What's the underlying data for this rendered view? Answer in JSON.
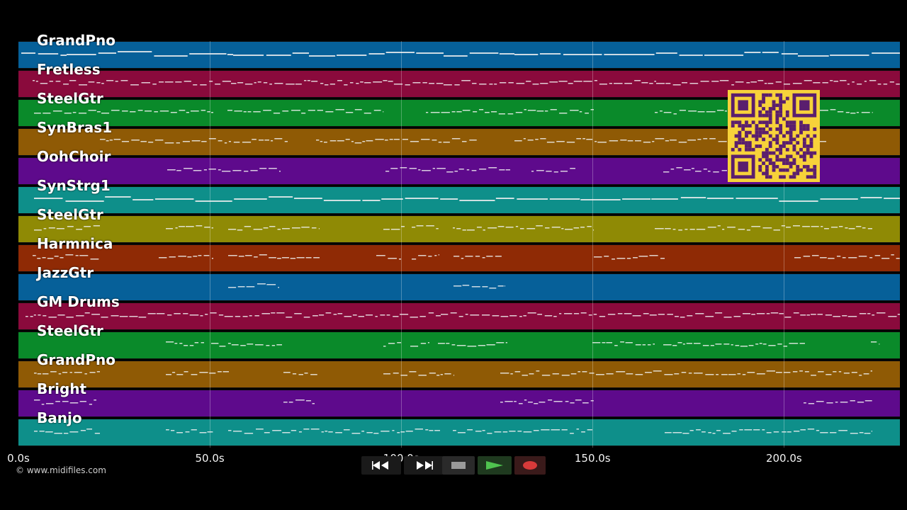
{
  "tracks": [
    {
      "name": "GrandPno",
      "color": "#066099"
    },
    {
      "name": "Fretless",
      "color": "#8a0a3c"
    },
    {
      "name": "SteelGtr",
      "color": "#0a8a2a"
    },
    {
      "name": "SynBras1",
      "color": "#8f5a05"
    },
    {
      "name": "OohChoir",
      "color": "#5e0a8c"
    },
    {
      "name": "SynStrg1",
      "color": "#0e8f8a"
    },
    {
      "name": "SteelGtr",
      "color": "#8f8a05"
    },
    {
      "name": "Harmnica",
      "color": "#8f2a05"
    },
    {
      "name": "JazzGtr",
      "color": "#066099"
    },
    {
      "name": "GM Drums",
      "color": "#8a0a3c"
    },
    {
      "name": "SteelGtr",
      "color": "#0a8a2a"
    },
    {
      "name": "GrandPno",
      "color": "#8f5a05"
    },
    {
      "name": "Bright",
      "color": "#5e0a8c"
    },
    {
      "name": "Banjo",
      "color": "#0e8f8a"
    }
  ],
  "timeline": {
    "ticks": [
      "0.0s",
      "50.0s",
      "100.0s",
      "150.0s",
      "200.0s"
    ],
    "tick_seconds": [
      0,
      50,
      100,
      150,
      200
    ],
    "max_seconds": 230.3
  },
  "notes": [
    [
      [
        4,
        68
      ],
      [
        68,
        138
      ],
      [
        140,
        303
      ],
      [
        303,
        410
      ],
      [
        410,
        600
      ],
      [
        600,
        700
      ],
      [
        700,
        840
      ],
      [
        840,
        1100
      ],
      [
        1100,
        1244
      ]
    ],
    [
      [
        20,
        300
      ],
      [
        300,
        600
      ],
      [
        600,
        900
      ],
      [
        900,
        1244
      ]
    ],
    [
      [
        22,
        275
      ],
      [
        295,
        515
      ],
      [
        575,
        812
      ],
      [
        898,
        1000
      ],
      [
        1130,
        1205
      ]
    ],
    [
      [
        115,
        380
      ],
      [
        420,
        650
      ],
      [
        700,
        1000
      ],
      [
        1030,
        1140
      ]
    ],
    [
      [
        210,
        370
      ],
      [
        518,
        694
      ],
      [
        724,
        786
      ],
      [
        910,
        1000
      ]
    ],
    [
      [
        22,
        1244
      ]
    ],
    [
      [
        22,
        115
      ],
      [
        208,
        275
      ],
      [
        296,
        370
      ],
      [
        372,
        425
      ],
      [
        515,
        545
      ],
      [
        555,
        594
      ],
      [
        613,
        812
      ],
      [
        898,
        1205
      ]
    ],
    [
      [
        20,
        115
      ],
      [
        198,
        275
      ],
      [
        296,
        425
      ],
      [
        505,
        540
      ],
      [
        555,
        594
      ],
      [
        614,
        682
      ],
      [
        812,
        912
      ],
      [
        1095,
        1244
      ]
    ],
    [
      [
        296,
        368
      ],
      [
        614,
        686
      ]
    ],
    [
      [
        10,
        596
      ],
      [
        596,
        1244
      ]
    ],
    [
      [
        208,
        262
      ],
      [
        272,
        372
      ],
      [
        515,
        540
      ],
      [
        553,
        580
      ],
      [
        592,
        690
      ],
      [
        810,
        898
      ],
      [
        910,
        1110
      ],
      [
        1203,
        1215
      ]
    ],
    [
      [
        22,
        115
      ],
      [
        208,
        297
      ],
      [
        374,
        424
      ],
      [
        515,
        615
      ],
      [
        680,
        1205
      ]
    ],
    [
      [
        22,
        110
      ],
      [
        374,
        418
      ],
      [
        680,
        812
      ],
      [
        1108,
        1205
      ]
    ],
    [
      [
        22,
        115
      ],
      [
        208,
        275
      ],
      [
        296,
        595
      ],
      [
        613,
        812
      ],
      [
        912,
        1205
      ]
    ]
  ],
  "qr_icon": "qr-code-icon",
  "transport": {
    "rewind_icon": "rewind-icon",
    "fast_forward_icon": "fast-forward-icon",
    "stop_icon": "stop-icon",
    "play_icon": "play-icon",
    "record_icon": "record-icon"
  },
  "copyright": "© www.midifiles.com"
}
